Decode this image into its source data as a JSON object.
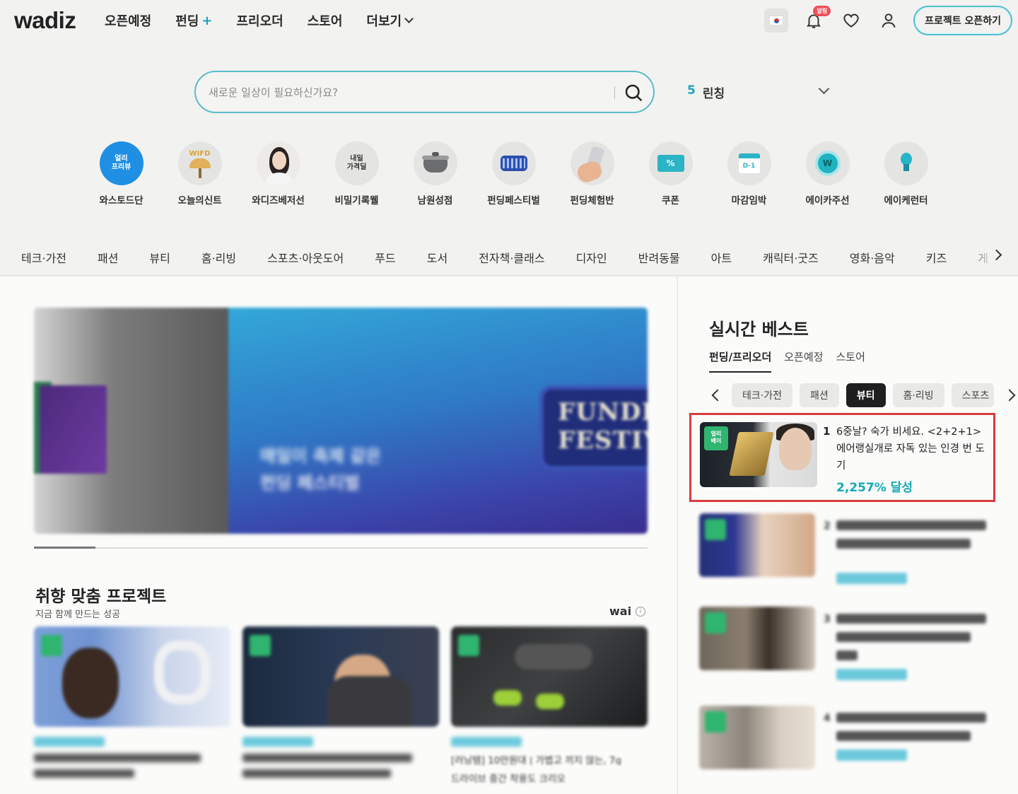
{
  "header": {
    "logo": "wadiz",
    "nav": [
      {
        "label": "오픈예정",
        "plus": "",
        "dropdown": false
      },
      {
        "label": "펀딩",
        "plus": "+",
        "dropdown": false
      },
      {
        "label": "프리오더",
        "plus": "",
        "dropdown": false
      },
      {
        "label": "스토어",
        "plus": "",
        "dropdown": false
      },
      {
        "label": "더보기",
        "plus": "",
        "dropdown": true
      }
    ],
    "notification_badge": "알림",
    "open_project_label": "프로젝트 오픈하기"
  },
  "search": {
    "placeholder": "새로운 일상이 필요하신가요?",
    "trending_rank": "5",
    "trending_keyword": "린칭"
  },
  "shortcuts": [
    {
      "label": "와스토드단",
      "icon": "wadiz-premium-icon",
      "bg": "#1a8fe0",
      "badge_text": "얼리\n프리뷰"
    },
    {
      "label": "오늘의신트",
      "icon": "lamp-icon",
      "bg": "#e6e5e0",
      "badge_text": "WIFD"
    },
    {
      "label": "와디즈베저선",
      "icon": "person-photo-icon",
      "bg": "#e6e6e6",
      "badge_text": ""
    },
    {
      "label": "비밀기록웰",
      "icon": "secret-deal-icon",
      "bg": "#e6e6e6",
      "badge_text": "내일\n가격딜"
    },
    {
      "label": "남원성점",
      "icon": "cooking-pot-icon",
      "bg": "#e6e6e6",
      "badge_text": ""
    },
    {
      "label": "펀딩페스티벌",
      "icon": "building-icon",
      "bg": "#e6e6e6",
      "badge_text": ""
    },
    {
      "label": "펀딩체험반",
      "icon": "phone-in-hand-icon",
      "bg": "#e6e6e6",
      "badge_text": ""
    },
    {
      "label": "쿠폰",
      "icon": "coupon-icon",
      "bg": "#e6e6e6",
      "badge_text": "%"
    },
    {
      "label": "마감임박",
      "icon": "calendar-d1-icon",
      "bg": "#e6e6e6",
      "badge_text": "D-1"
    },
    {
      "label": "에이카주선",
      "icon": "w-badge-icon",
      "bg": "#e6e6e6",
      "badge_text": "W"
    },
    {
      "label": "에이케런터",
      "icon": "lightbulb-icon",
      "bg": "#e6e6e6",
      "badge_text": ""
    }
  ],
  "categories": [
    "테크·가전",
    "패션",
    "뷰티",
    "홈·리빙",
    "스포츠·아웃도어",
    "푸드",
    "도서",
    "전자책·클래스",
    "디자인",
    "반려동물",
    "아트",
    "캐릭터·굿즈",
    "영화·음악",
    "키즈",
    "게"
  ],
  "banner": {
    "copy_line1": "매일이 축제 같은",
    "copy_line2": "펀딩 페스티벌",
    "festival_text": "FUNDIN\nFESTIVA",
    "progress": 0.1
  },
  "recommend": {
    "title": "취향 맞춤 프로젝트",
    "subtitle": "지금 함께 만드는 성공",
    "ai_badge": "wai",
    "ai_info": "i",
    "cards": [
      {
        "line2": "",
        "line3": ""
      },
      {
        "line2": "",
        "line3": ""
      },
      {
        "line2": "[러닝템] 10만원대 | 가볍고 끼지 않는, 7g",
        "line3": "드라이브 중간 착용도 크리오"
      }
    ]
  },
  "sidebar": {
    "title": "실시간 베스트",
    "tabs": [
      "펀딩/프리오더",
      "오픈예정",
      "스토어"
    ],
    "chips": [
      "테크·가전",
      "패션",
      "뷰티",
      "홈·리빙",
      "스포츠"
    ],
    "active_chip": "뷰티",
    "rank1": {
      "number": "1",
      "title": "6중날? 숙가 비세요. <2+2+1> 에어랭실개로 자독 있는 인경 번 도기",
      "rate": "2,257% 달성",
      "tag_text": "얼리\n베이"
    },
    "ranks": [
      {
        "number": "2"
      },
      {
        "number": "3"
      },
      {
        "number": "4"
      }
    ]
  }
}
